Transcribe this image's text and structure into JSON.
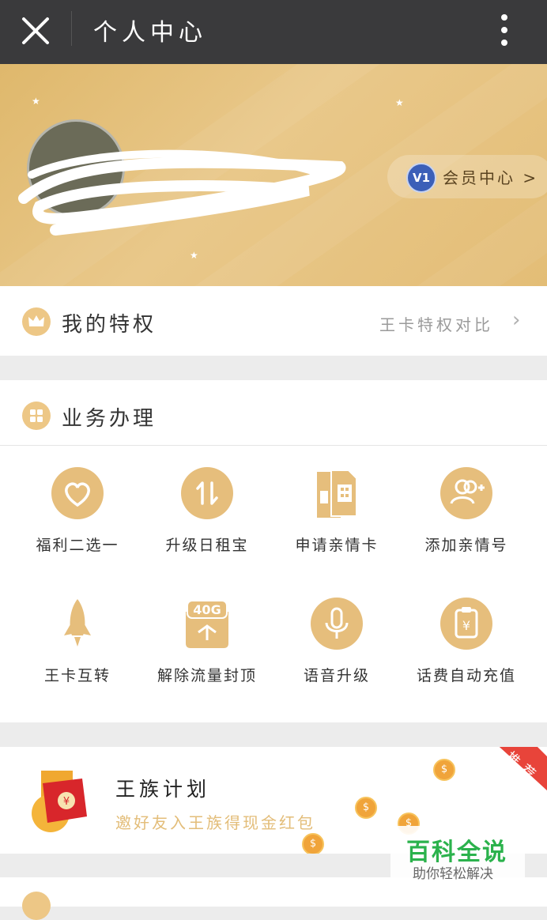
{
  "header": {
    "title": "个人中心"
  },
  "profile": {
    "member_center": "会员中心 >",
    "level_badge": "V1"
  },
  "privileges": {
    "label": "我的特权",
    "compare": "王卡特权对比"
  },
  "business": {
    "label": "业务办理",
    "items": [
      {
        "label": "福利二选一",
        "icon": "heart-icon"
      },
      {
        "label": "升级日租宝",
        "icon": "up-down-arrows-icon"
      },
      {
        "label": "申请亲情卡",
        "icon": "sim-card-icon"
      },
      {
        "label": "添加亲情号",
        "icon": "add-contact-icon"
      },
      {
        "label": "王卡互转",
        "icon": "rocket-icon"
      },
      {
        "label": "解除流量封顶",
        "icon": "data-40g-icon"
      },
      {
        "label": "语音升级",
        "icon": "microphone-icon"
      },
      {
        "label": "话费自动充值",
        "icon": "auto-recharge-icon"
      }
    ],
    "badge_40g": "40G"
  },
  "plan": {
    "title": "王族计划",
    "subtitle": "邀好友入王族得现金红包",
    "ribbon": "推荐",
    "coin_symbol": "$"
  },
  "watermark": {
    "title": "百科全说",
    "subtitle": "助你轻松解决"
  }
}
